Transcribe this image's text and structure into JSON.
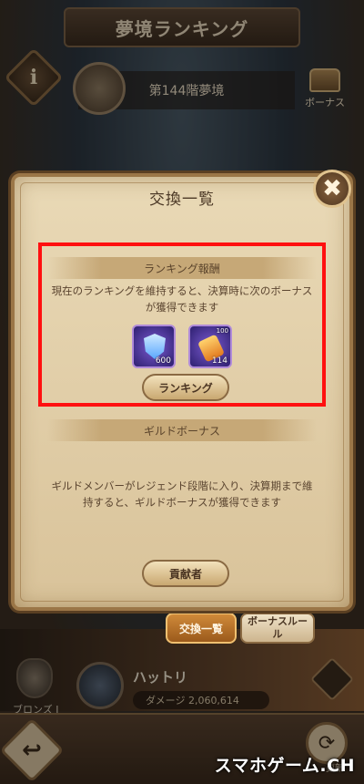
{
  "header": {
    "title": "夢境ランキング",
    "info_symbol": "i"
  },
  "floor": {
    "label": "第144階夢境"
  },
  "bonus_button": {
    "label": "ボーナス"
  },
  "dialog": {
    "title": "交換一覧",
    "close_symbol": "✖",
    "ranking_reward": {
      "heading": "ランキング報酬",
      "description": "現在のランキングを維持すると、決算時に次のボーナスが獲得できます",
      "items": [
        {
          "icon": "shield-crest-icon",
          "count": "600"
        },
        {
          "icon": "scroll-icon",
          "count": "114",
          "tag": "100"
        }
      ],
      "button_label": "ランキング"
    },
    "guild_bonus": {
      "heading": "ギルドボーナス",
      "description": "ギルドメンバーがレジェンド段階に入り、決算期まで維持すると、ギルドボーナスが獲得できます",
      "button_label": "貢献者"
    }
  },
  "tabs": {
    "exchange": "交換一覧",
    "bonus_rule": "ボーナスルール"
  },
  "player": {
    "rank": "ブロンズ Ⅰ",
    "name": "ハットリ",
    "damage": "ダメージ 2,060,614"
  },
  "nav": {
    "back_symbol": "↩",
    "refresh_symbol": "⟳",
    "refresh_label": "更新"
  },
  "watermark": "スマホゲーム.CH",
  "colors": {
    "highlight": "#ff1010",
    "parchment": "#e9d9b6",
    "accent": "#d08a3a"
  }
}
